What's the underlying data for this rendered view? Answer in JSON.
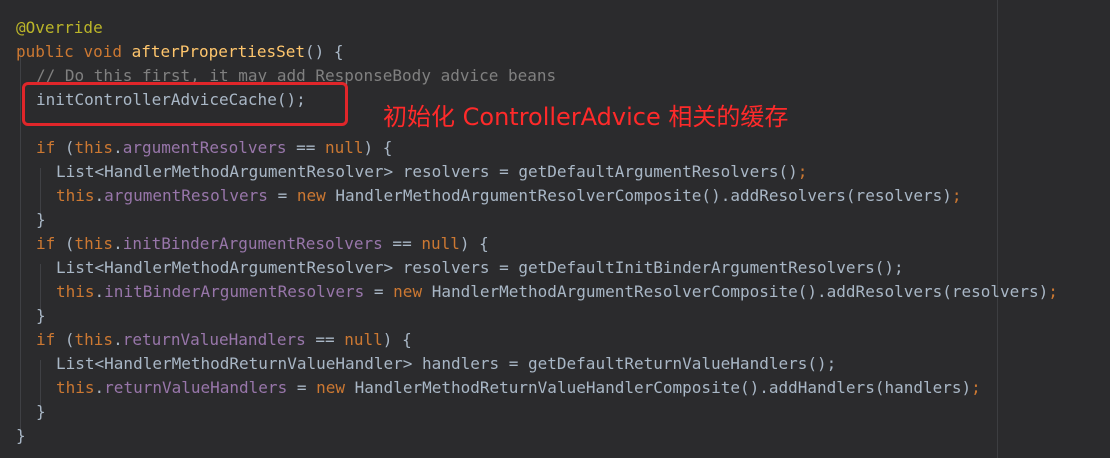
{
  "code": {
    "line1": "@Override",
    "line2": {
      "kw1": "public",
      "kw2": "void",
      "fn": "afterPropertiesSet",
      "rest": "() {"
    },
    "line3": "// Do this first, it may add ResponseBody advice beans",
    "line4": "initControllerAdviceCache();",
    "line6": {
      "kw": "if",
      "p1": " (",
      "this": "this",
      "dot": ".",
      "field": "argumentResolvers",
      "op": " == ",
      "null": "null",
      "end": ") {"
    },
    "line7": "List<HandlerMethodArgumentResolver> resolvers = getDefaultArgumentResolvers();",
    "line8": {
      "this": "this",
      "dot": ".",
      "field": "argumentResolvers",
      "eq": " = ",
      "new": "new",
      "rest": " HandlerMethodArgumentResolverComposite().addResolvers(resolvers)",
      "semi": ";"
    },
    "line9": "}",
    "line10": {
      "kw": "if",
      "p1": " (",
      "this": "this",
      "dot": ".",
      "field": "initBinderArgumentResolvers",
      "op": " == ",
      "null": "null",
      "end": ") {"
    },
    "line11": "List<HandlerMethodArgumentResolver> resolvers = getDefaultInitBinderArgumentResolvers();",
    "line12": {
      "this": "this",
      "dot": ".",
      "field": "initBinderArgumentResolvers",
      "eq": " = ",
      "new": "new",
      "rest": " HandlerMethodArgumentResolverComposite().addResolvers(resolvers)",
      "semi": ";"
    },
    "line13": "}",
    "line14": {
      "kw": "if",
      "p1": " (",
      "this": "this",
      "dot": ".",
      "field": "returnValueHandlers",
      "op": " == ",
      "null": "null",
      "end": ") {"
    },
    "line15": "List<HandlerMethodReturnValueHandler> handlers = getDefaultReturnValueHandlers();",
    "line16": {
      "this": "this",
      "dot": ".",
      "field": "returnValueHandlers",
      "eq": " = ",
      "new": "new",
      "rest": " HandlerMethodReturnValueHandlerComposite().addHandlers(handlers)",
      "semi": ";"
    },
    "line17": "}",
    "line18": "}"
  },
  "annotation": "初始化 ControllerAdvice 相关的缓存",
  "colors": {
    "background": "#2b2b2d",
    "keyword": "#cc7832",
    "annotation_tag": "#bbb529",
    "method_name": "#ffc66d",
    "field": "#9876aa",
    "comment": "#808080",
    "highlight": "#e0262a"
  }
}
